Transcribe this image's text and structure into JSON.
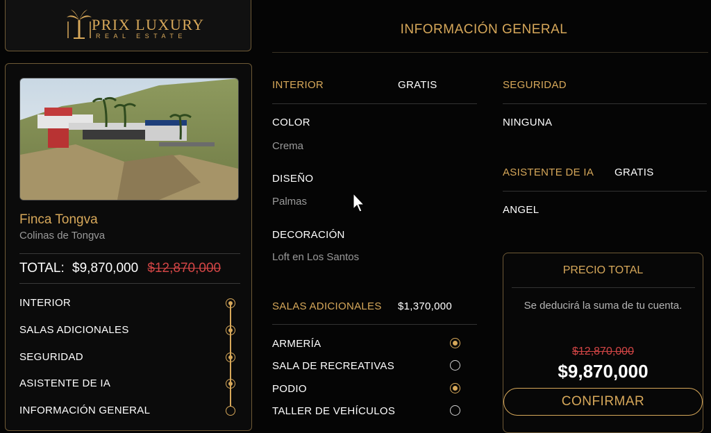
{
  "logo": {
    "name": "PRIX LUXURY",
    "subtitle": "REAL ESTATE"
  },
  "property": {
    "name": "Finca Tongva",
    "area": "Colinas de Tongva"
  },
  "total": {
    "label": "TOTAL:",
    "value": "$9,870,000",
    "old_value": "$12,870,000"
  },
  "steps": [
    {
      "label": "INTERIOR",
      "completed": true
    },
    {
      "label": "SALAS ADICIONALES",
      "completed": true
    },
    {
      "label": "SEGURIDAD",
      "completed": true
    },
    {
      "label": "ASISTENTE DE IA",
      "completed": true
    },
    {
      "label": "INFORMACIÓN GENERAL",
      "completed": false
    }
  ],
  "section_title": "INFORMACIÓN GENERAL",
  "interior": {
    "label": "INTERIOR",
    "price": "GRATIS",
    "color_label": "COLOR",
    "color_value": "Crema",
    "design_label": "DISEÑO",
    "design_value": "Palmas",
    "decor_label": "DECORACIÓN",
    "decor_value": "Loft en Los Santos"
  },
  "rooms": {
    "label": "SALAS ADICIONALES",
    "price": "$1,370,000",
    "items": [
      {
        "label": "ARMERÍA",
        "selected": true
      },
      {
        "label": "SALA DE RECREATIVAS",
        "selected": false
      },
      {
        "label": "PODIO",
        "selected": true
      },
      {
        "label": "TALLER DE VEHÍCULOS",
        "selected": false
      }
    ]
  },
  "security": {
    "label": "SEGURIDAD",
    "value": "NINGUNA"
  },
  "ai": {
    "label": "ASISTENTE DE IA",
    "price": "GRATIS",
    "value": "ANGEL"
  },
  "price_box": {
    "title": "PRECIO TOTAL",
    "note": "Se deducirá la suma de tu cuenta.",
    "old_price": "$12,870,000",
    "price": "$9,870,000",
    "confirm_label": "CONFIRMAR"
  },
  "colors": {
    "accent": "#d7a85a",
    "strike": "#d24545",
    "background": "#050505"
  }
}
